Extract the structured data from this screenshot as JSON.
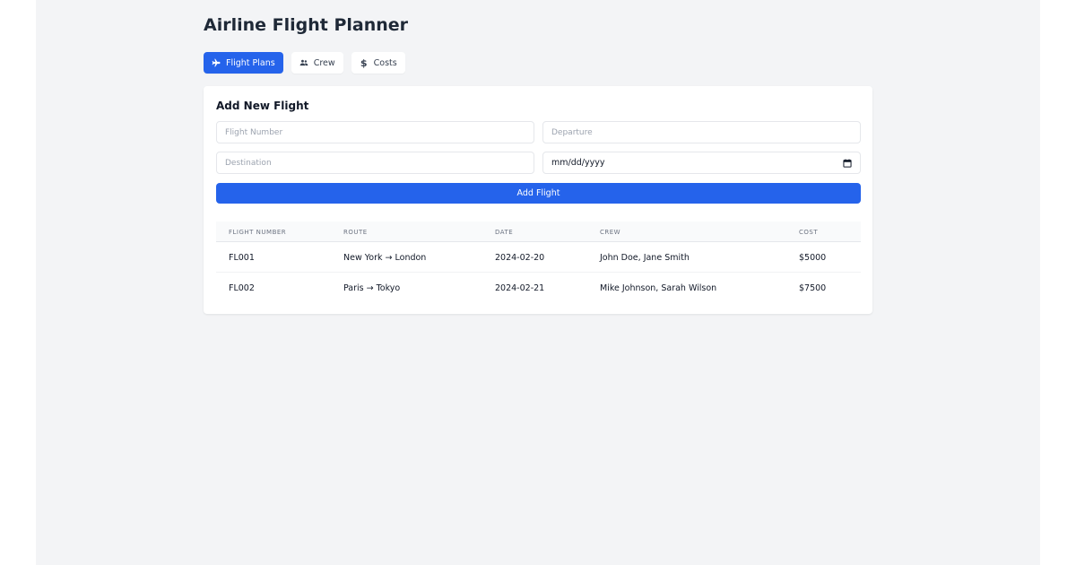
{
  "app": {
    "title": "Airline Flight Planner"
  },
  "tabs": [
    {
      "label": "Flight Plans",
      "icon": "plane-icon",
      "active": true
    },
    {
      "label": "Crew",
      "icon": "users-icon",
      "active": false
    },
    {
      "label": "Costs",
      "icon": "dollar-icon",
      "active": false
    }
  ],
  "form": {
    "title": "Add New Flight",
    "flight_number_placeholder": "Flight Number",
    "departure_placeholder": "Departure",
    "destination_placeholder": "Destination",
    "date_placeholder": "mm/dd/yyyy",
    "submit_label": "Add Flight"
  },
  "table": {
    "headers": [
      "FLIGHT NUMBER",
      "ROUTE",
      "DATE",
      "CREW",
      "COST"
    ],
    "rows": [
      [
        "FL001",
        "New York → London",
        "2024-02-20",
        "John Doe, Jane Smith",
        "$5000"
      ],
      [
        "FL002",
        "Paris → Tokyo",
        "2024-02-21",
        "Mike Johnson, Sarah Wilson",
        "$7500"
      ]
    ]
  },
  "colors": {
    "accent": "#2563eb",
    "background": "#f3f4f6",
    "card": "#ffffff"
  }
}
